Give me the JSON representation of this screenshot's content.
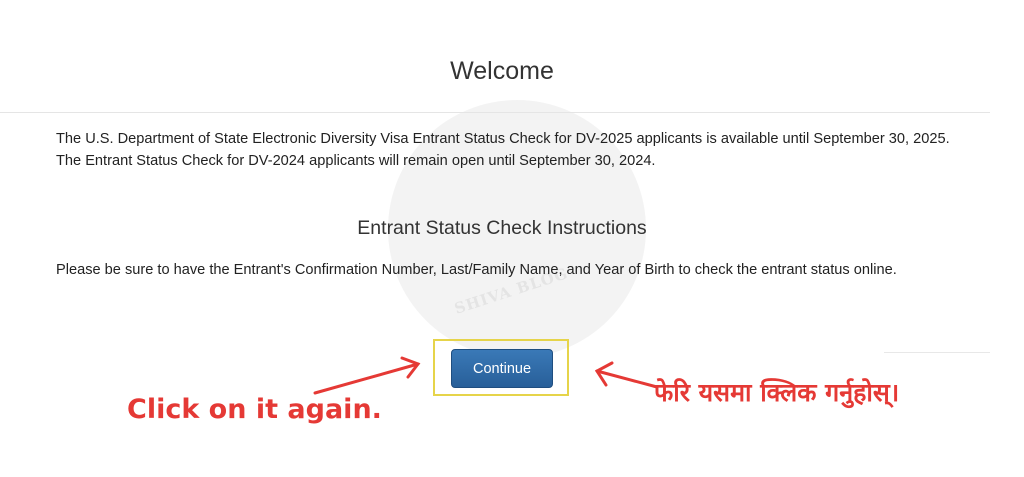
{
  "header": {
    "title": "Welcome"
  },
  "main": {
    "intro_text": "The U.S. Department of State Electronic Diversity Visa Entrant Status Check for DV-2025 applicants is available until September 30, 2025. The Entrant Status Check for DV-2024 applicants will remain open until September 30, 2024.",
    "instructions_heading": "Entrant Status Check Instructions",
    "instructions_text": "Please be sure to have the Entrant's Confirmation Number, Last/Family Name, and Year of Birth to check the entrant status online.",
    "continue_label": "Continue"
  },
  "watermark": {
    "text": "SHIVA BLOG"
  },
  "annotations": {
    "english": "Click on it again.",
    "nepali": "फेरि यसमा क्लिक गर्नुहोस्।",
    "color": "#e53935",
    "highlight_color": "#e6d44a"
  },
  "colors": {
    "button": "#2f6ca8"
  }
}
